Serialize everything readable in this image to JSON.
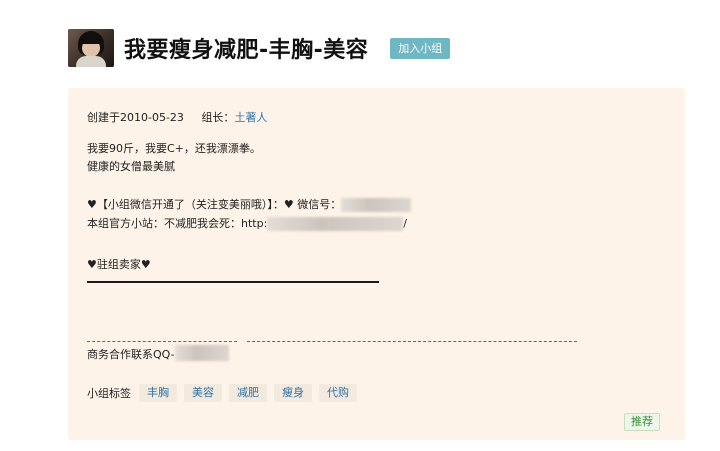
{
  "group": {
    "title": "我要瘦身减肥-丰胸-美容",
    "join_label": "加入小组"
  },
  "info": {
    "created": "创建于2010-05-23",
    "leader_label": "组长：",
    "leader_name": "土著人",
    "desc_line1": "我要90斤，我要C+，还我漂漂拳。",
    "desc_line2": "健康的女僧最美腻",
    "wechat_line": "♥【小组微信开通了（关注变美丽哦）】：♥ 微信号：",
    "site_line_prefix": "本组官方小站：不减肥我会死：http:",
    "site_line_suffix": "/",
    "sellers_heading": "♥驻组卖家♥",
    "business_contact": "商务合作联系QQ-"
  },
  "tags": {
    "label": "小组标签",
    "items": [
      "丰胸",
      "美容",
      "减肥",
      "瘦身",
      "代购"
    ]
  },
  "actions": {
    "recommend_label": "推荐"
  },
  "colors": {
    "card_background": "#fdf3e8",
    "join_button": "#6fb7c3",
    "link": "#3173a8",
    "recommend_text": "#3d8f3d"
  }
}
